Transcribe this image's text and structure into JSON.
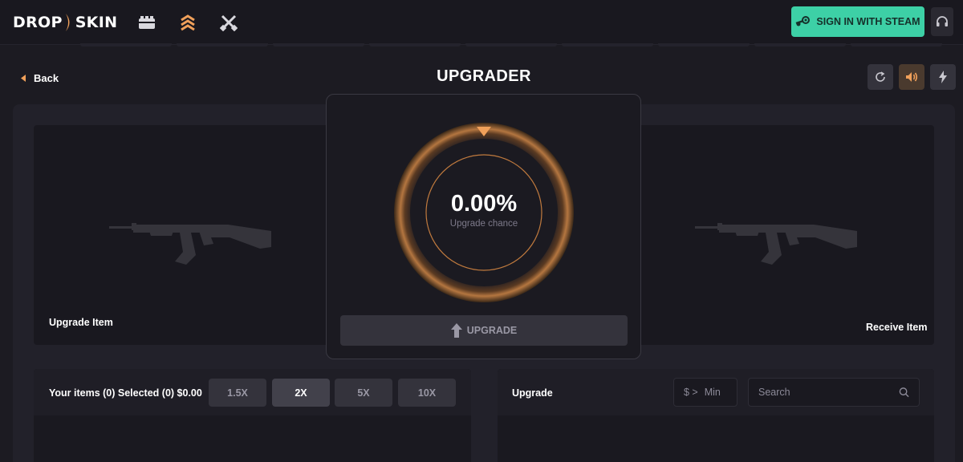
{
  "app": {
    "logo_left": "DROP",
    "logo_right": "SKIN",
    "nav_icons": [
      "cases-icon",
      "upgrader-icon",
      "battle-icon"
    ],
    "signin_label": "SIGN IN WITH STEAM",
    "accent_color": "#f0a05a",
    "signin_color": "#3dd0a6"
  },
  "header": {
    "back_label": "Back",
    "title": "UPGRADER"
  },
  "controls": [
    "refresh-icon",
    "sound-icon",
    "lightning-icon"
  ],
  "upgrader": {
    "left_label": "Upgrade Item",
    "right_label": "Receive Item",
    "chance_value": "0.00%",
    "chance_label": "Upgrade chance",
    "chance_fraction": 0,
    "button_label": "UPGRADE"
  },
  "inventory": {
    "summary": "Your items (0) Selected (0) $0.00",
    "multipliers": [
      {
        "label": "1.5X",
        "active": false
      },
      {
        "label": "2X",
        "active": true
      },
      {
        "label": "5X",
        "active": false
      },
      {
        "label": "10X",
        "active": false
      }
    ]
  },
  "target": {
    "title": "Upgrade",
    "price_prefix": "$ >",
    "price_placeholder": "Min",
    "search_placeholder": "Search"
  }
}
